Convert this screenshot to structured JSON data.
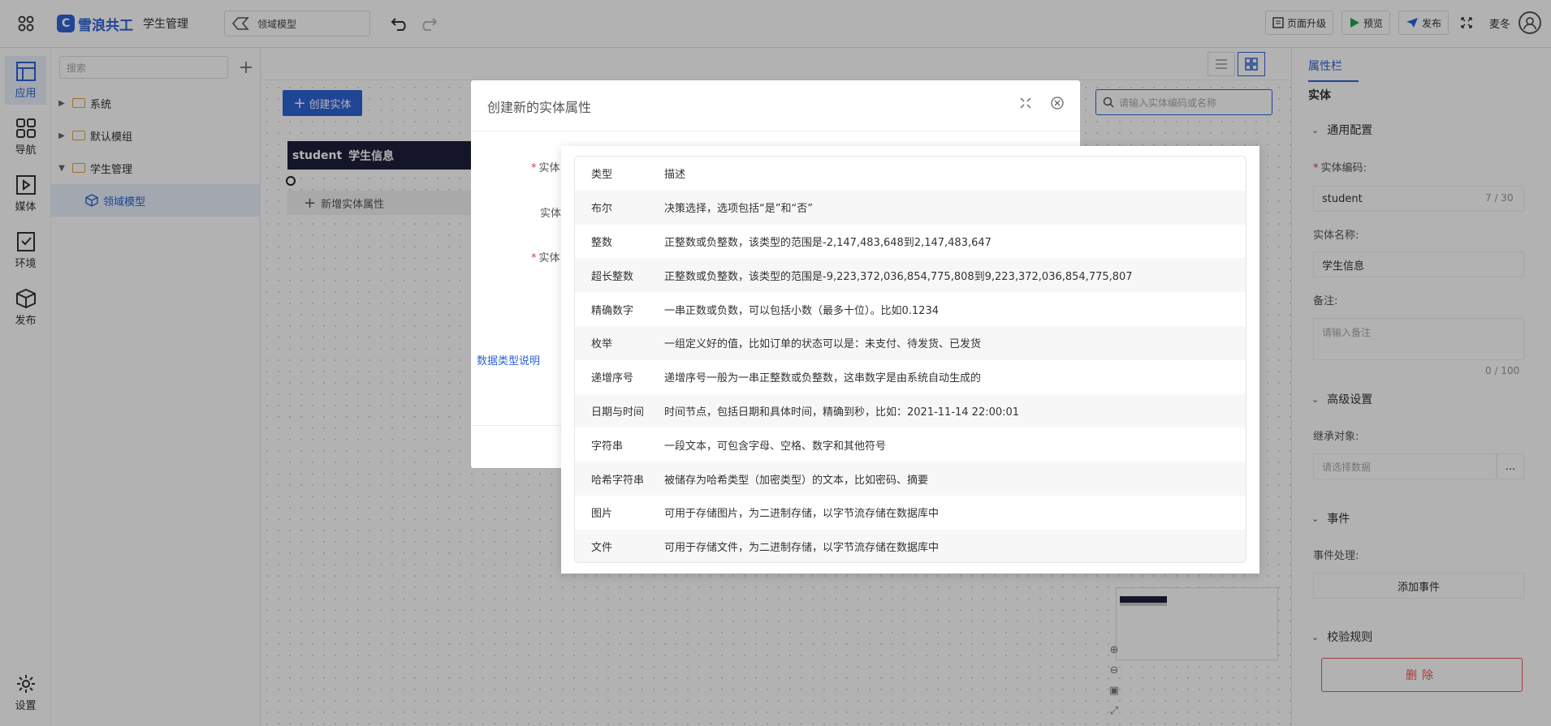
{
  "topbar": {
    "brand": "雪浪共工",
    "app_name": "学生管理",
    "page_select": "领域模型",
    "page_upgrade": "页面升级",
    "preview": "预览",
    "publish": "发布",
    "user_name": "麦冬"
  },
  "leftrail": {
    "items": [
      {
        "label": "应用",
        "icon": "app-icon"
      },
      {
        "label": "导航",
        "icon": "grid-icon"
      },
      {
        "label": "媒体",
        "icon": "media-icon"
      },
      {
        "label": "环境",
        "icon": "env-icon"
      },
      {
        "label": "发布",
        "icon": "cube-icon"
      }
    ],
    "settings": "设置"
  },
  "tree": {
    "search_placeholder": "搜索",
    "nodes": [
      {
        "label": "系统",
        "expanded": false
      },
      {
        "label": "默认模组",
        "expanded": false
      },
      {
        "label": "学生管理",
        "expanded": true
      },
      {
        "label": "领域模型",
        "selected": true
      }
    ]
  },
  "canvas": {
    "create_entity": "创建实体",
    "entity_search_placeholder": "请输入实体编码或名称",
    "entity": {
      "code": "student",
      "name": "学生信息",
      "add_attr": "新增实体属性"
    }
  },
  "rightpanel": {
    "tab": "属性栏",
    "entity_title": "实体",
    "general": "通用配置",
    "code_label": "实体编码:",
    "code_value": "student",
    "code_count": "7 / 30",
    "name_label": "实体名称:",
    "name_value": "学生信息",
    "remark_label": "备注:",
    "remark_placeholder": "请输入备注",
    "remark_count": "0 / 100",
    "advanced": "高级设置",
    "inherit_label": "继承对象:",
    "inherit_placeholder": "请选择数据",
    "inherit_more": "...",
    "events": "事件",
    "event_label": "事件处理:",
    "add_event": "添加事件",
    "validation": "校验规则",
    "delete": "删除"
  },
  "dialog": {
    "title": "创建新的实体属性",
    "label_1": "实体",
    "label_2": "实体",
    "label_3": "实体",
    "data_type_link": "数据类型说明"
  },
  "popover": {
    "header": {
      "type": "类型",
      "desc": "描述"
    },
    "rows": [
      {
        "type": "布尔",
        "desc": "决策选择，选项包括“是”和“否”"
      },
      {
        "type": "整数",
        "desc": "正整数或负整数，该类型的范围是-2,147,483,648到2,147,483,647"
      },
      {
        "type": "超长整数",
        "desc": "正整数或负整数，该类型的范围是-9,223,372,036,854,775,808到9,223,372,036,854,775,807"
      },
      {
        "type": "精确数字",
        "desc": "一串正数或负数，可以包括小数（最多十位）。比如0.1234"
      },
      {
        "type": "枚举",
        "desc": "一组定义好的值，比如订单的状态可以是：未支付、待发货、已发货"
      },
      {
        "type": "递增序号",
        "desc": "递增序号一般为一串正整数或负整数，这串数字是由系统自动生成的"
      },
      {
        "type": "日期与时间",
        "desc": "时间节点，包括日期和具体时间，精确到秒，比如：2021-11-14 22:00:01"
      },
      {
        "type": "字符串",
        "desc": "一段文本，可包含字母、空格、数字和其他符号"
      },
      {
        "type": "哈希字符串",
        "desc": "被储存为哈希类型（加密类型）的文本，比如密码、摘要"
      },
      {
        "type": "图片",
        "desc": "可用于存储图片，为二进制存储，以字节流存储在数据库中"
      },
      {
        "type": "文件",
        "desc": "可用于存储文件，为二进制存储，以字节流存储在数据库中"
      }
    ]
  },
  "colors": {
    "accent": "#2d63d6",
    "danger": "#e55555",
    "entity_header": "#1e1f3a"
  }
}
